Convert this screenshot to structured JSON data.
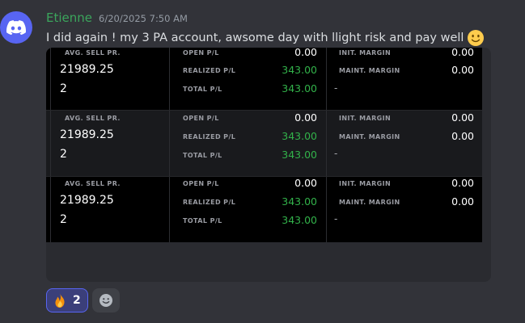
{
  "message": {
    "username": "Etienne",
    "timestamp": "6/20/2025 7:50 AM",
    "text": "I did again ! my 3 PA account, awsome day with llight risk and pay well",
    "emoji": "slightly-smiling-face"
  },
  "colors": {
    "username": "#3ba55c",
    "brand": "#5865f2",
    "profit_green": "#32b24a",
    "background": "#323339"
  },
  "attachment": {
    "accounts": [
      {
        "avg_sell_label": "AVG. SELL PR.",
        "avg_sell_value": "21989.25",
        "quantity": "2",
        "open_pl_label": "OPEN P/L",
        "open_pl_value": "0.00",
        "realized_pl_label": "REALIZED P/L",
        "realized_pl_value": "343.00",
        "total_pl_label": "TOTAL P/L",
        "total_pl_value": "343.00",
        "init_margin_label": "INIT. MARGIN",
        "init_margin_value": "0.00",
        "maint_margin_label": "MAINT. MARGIN",
        "maint_margin_value": "0.00",
        "extra": "-"
      },
      {
        "avg_sell_label": "AVG. SELL PR.",
        "avg_sell_value": "21989.25",
        "quantity": "2",
        "open_pl_label": "OPEN P/L",
        "open_pl_value": "0.00",
        "realized_pl_label": "REALIZED P/L",
        "realized_pl_value": "343.00",
        "total_pl_label": "TOTAL P/L",
        "total_pl_value": "343.00",
        "init_margin_label": "INIT. MARGIN",
        "init_margin_value": "0.00",
        "maint_margin_label": "MAINT. MARGIN",
        "maint_margin_value": "0.00",
        "extra": "-"
      },
      {
        "avg_sell_label": "AVG. SELL PR.",
        "avg_sell_value": "21989.25",
        "quantity": "2",
        "open_pl_label": "OPEN P/L",
        "open_pl_value": "0.00",
        "realized_pl_label": "REALIZED P/L",
        "realized_pl_value": "343.00",
        "total_pl_label": "TOTAL P/L",
        "total_pl_value": "343.00",
        "init_margin_label": "INIT. MARGIN",
        "init_margin_value": "0.00",
        "maint_margin_label": "MAINT. MARGIN",
        "maint_margin_value": "0.00",
        "extra": "-"
      }
    ]
  },
  "reactions": [
    {
      "emoji": "fire-icon",
      "count": "2"
    }
  ],
  "add_reaction_icon": "smiley-icon"
}
